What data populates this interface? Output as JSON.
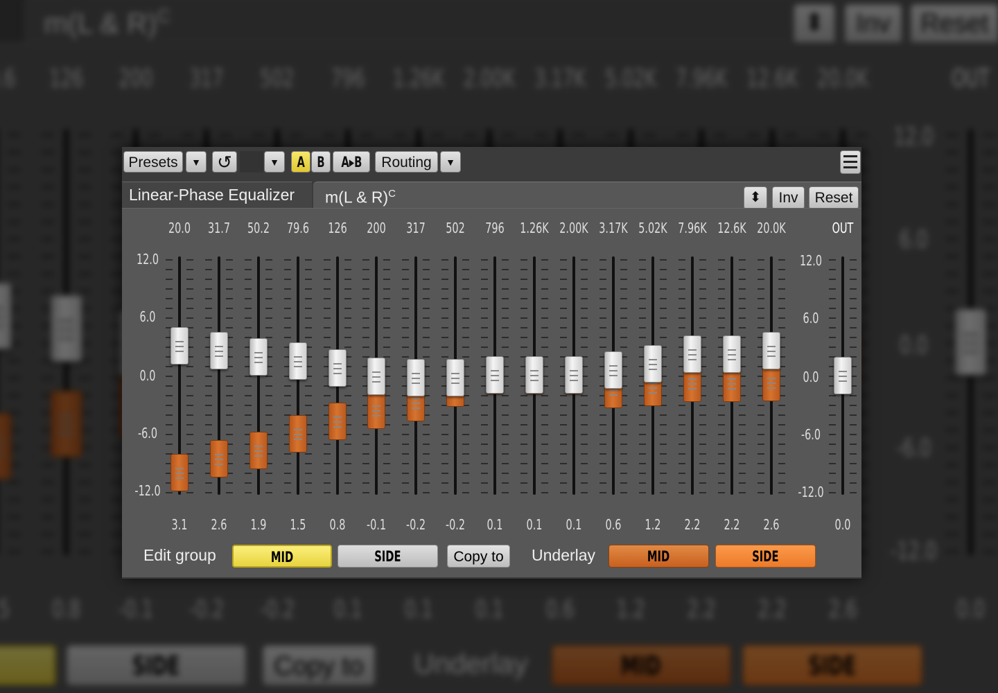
{
  "colors": {
    "accent_yellow": "#f2e05a",
    "side_orange": "#d6732f",
    "underlay_side": "#f0873a",
    "panel": "#575757"
  },
  "toolbar": {
    "presets": "Presets",
    "dropdown_icon": "▼",
    "reload_icon": "↺",
    "a": "A",
    "b": "B",
    "a_to_b": "A▸B",
    "routing": "Routing",
    "menu_icon": "hamburger-menu"
  },
  "tabs": {
    "plugin_name": "Linear-Phase Equalizer",
    "channel": "m(L & R)",
    "channel_sup": "C"
  },
  "header_buttons": {
    "updown": "⬍",
    "inv": "Inv",
    "reset": "Reset"
  },
  "bands": {
    "frequencies": [
      "20.0",
      "31.7",
      "50.2",
      "79.6",
      "126",
      "200",
      "317",
      "502",
      "796",
      "1.26K",
      "2.00K",
      "3.17K",
      "5.02K",
      "7.96K",
      "12.6K",
      "20.0K"
    ],
    "mid_gain_db": [
      "3.1",
      "2.6",
      "1.9",
      "1.5",
      "0.8",
      "-0.1",
      "-0.2",
      "-0.2",
      "0.1",
      "0.1",
      "0.1",
      "0.6",
      "1.2",
      "2.2",
      "2.2",
      "2.6"
    ],
    "side_gain_db": [
      -10.0,
      -8.6,
      -7.7,
      -6.0,
      -4.7,
      -3.6,
      -2.8,
      -1.3,
      0,
      0,
      0,
      -1.4,
      -1.2,
      -0.8,
      -0.8,
      -0.7
    ]
  },
  "scale": [
    "12.0",
    "6.0",
    "0.0",
    "-6.0",
    "-12.0"
  ],
  "output": {
    "label": "OUT",
    "value": "0.0"
  },
  "footer": {
    "edit_group": "Edit group",
    "mid": "MID",
    "side": "SIDE",
    "copy_to": "Copy to",
    "underlay": "Underlay",
    "underlay_mid": "MID",
    "underlay_side": "SIDE"
  }
}
